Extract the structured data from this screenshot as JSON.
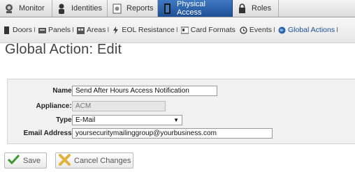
{
  "top_tabs": [
    {
      "label": "Monitor",
      "icon": "monitor-icon"
    },
    {
      "label": "Identities",
      "icon": "identities-icon"
    },
    {
      "label": "Reports",
      "icon": "reports-icon"
    },
    {
      "label": "Physical Access",
      "icon": "physical-access-icon",
      "active": true
    },
    {
      "label": "Roles",
      "icon": "roles-icon"
    }
  ],
  "sub_nav": [
    {
      "label": "Doors",
      "sep": "I",
      "icon": "doors-icon"
    },
    {
      "label": "Panels",
      "sep": "I",
      "icon": "panels-icon"
    },
    {
      "label": "Areas",
      "sep": "I",
      "icon": "areas-icon"
    },
    {
      "label": "EOL Resistance",
      "sep": "I",
      "icon": "eol-resistance-icon"
    },
    {
      "label": "Card Formats",
      "sep": "",
      "icon": "card-formats-icon"
    },
    {
      "label": "Events",
      "sep": "I",
      "icon": "events-icon"
    },
    {
      "label": "Global Actions",
      "sep": "I",
      "icon": "global-actions-icon",
      "active": true
    }
  ],
  "page_title": "Global Action: Edit",
  "form": {
    "name_label": "Name:",
    "name_value": "Send After Hours Access Notification",
    "appliance_label": "Appliance::",
    "appliance_value": "ACM",
    "type_label": "Type:",
    "type_value": "E-Mail",
    "email_label": "Email Address:",
    "email_value": "yoursecuritymailinggroup@yourbusiness.com"
  },
  "buttons": {
    "save_label": "Save",
    "cancel_label": "Cancel Changes"
  },
  "colors": {
    "active_tab": "#2a62ad",
    "title_text": "#444444",
    "panel_bg": "#f1f1f1"
  }
}
